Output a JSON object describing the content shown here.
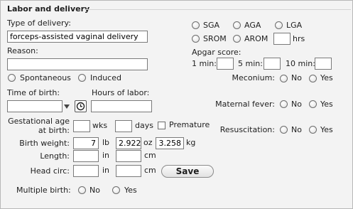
{
  "section": {
    "title": "Labor and delivery"
  },
  "delivery": {
    "type_label": "Type of delivery:",
    "type_value": "forceps-assisted vaginal delivery",
    "reason_label": "Reason:",
    "reason_value": "",
    "onset_options": [
      "Spontaneous",
      "Induced"
    ]
  },
  "size_options": [
    "SGA",
    "AGA",
    "LGA"
  ],
  "membrane": {
    "options": [
      "SROM",
      "AROM"
    ],
    "hours_value": "",
    "hours_unit": "hrs"
  },
  "apgar": {
    "label": "Apgar score:",
    "fields": [
      {
        "label": "1 min:",
        "value": ""
      },
      {
        "label": "5 min:",
        "value": ""
      },
      {
        "label": "10 min:",
        "value": ""
      }
    ]
  },
  "time_of_birth": {
    "label": "Time of birth:",
    "value": ""
  },
  "hours_of_labor": {
    "label": "Hours of labor:",
    "value": ""
  },
  "gestational_age": {
    "label_line1": "Gestational age",
    "label_line2": "at birth:",
    "weeks_value": "",
    "weeks_unit": "wks",
    "days_value": "",
    "days_unit": "days",
    "premature_label": "Premature"
  },
  "birth_weight": {
    "label": "Birth weight:",
    "lbs_value": "7",
    "lbs_unit": "lb",
    "oz_value": "2.922",
    "oz_unit": "oz",
    "kg_value": "3.258",
    "kg_unit": "kg"
  },
  "length": {
    "label": "Length:",
    "in_value": "",
    "in_unit": "in",
    "cm_value": "",
    "cm_unit": "cm"
  },
  "head_circ": {
    "label": "Head circ:",
    "in_value": "",
    "in_unit": "in",
    "cm_value": "",
    "cm_unit": "cm"
  },
  "save_label": "Save",
  "multiple_birth": {
    "label": "Multiple birth:",
    "no": "No",
    "yes": "Yes"
  },
  "meconium": {
    "label": "Meconium:",
    "no": "No",
    "yes": "Yes"
  },
  "maternal_fever": {
    "label": "Maternal fever:",
    "no": "No",
    "yes": "Yes"
  },
  "resuscitation": {
    "label": "Resuscitation:",
    "no": "No",
    "yes": "Yes"
  }
}
